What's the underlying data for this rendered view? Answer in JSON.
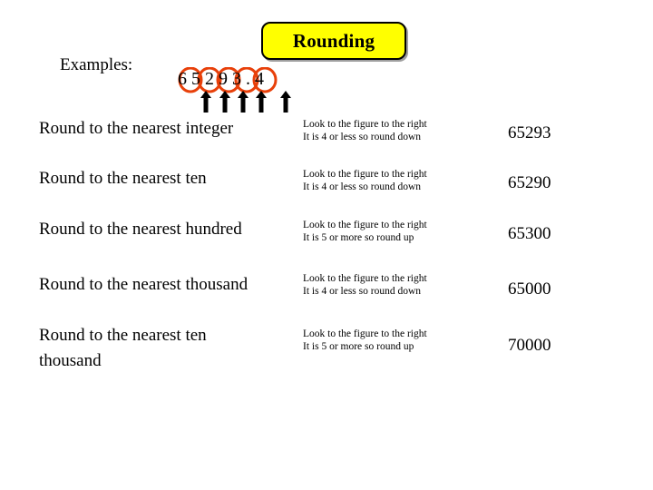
{
  "slide": {
    "title": "Rounding",
    "examples_label": "Examples:",
    "example_number": {
      "digits": "6 5 2 9 3",
      "decimal_part": ". 4",
      "full_text": "6 5 2 9 3 . 4",
      "circled_digits": [
        "6",
        "5",
        "2",
        "9",
        "3"
      ],
      "circle_color": "#e8400a",
      "arrow_color": "#000000",
      "arrow_count": 5
    },
    "title_box": {
      "fill_color": "#ffff00",
      "border_color": "#000000"
    },
    "rows": [
      {
        "label": "Round to the nearest integer",
        "note_line1": "Look to the figure to the right",
        "note_line2": "It is 4 or less so round down",
        "result": "65293"
      },
      {
        "label": "Round to the nearest ten",
        "note_line1": "Look to the figure to the right",
        "note_line2": "It is 4 or less so round down",
        "result": "65290"
      },
      {
        "label": "Round to the nearest hundred",
        "note_line1": "Look to the figure to the right",
        "note_line2": "It is 5 or more so round up",
        "result": "65300"
      },
      {
        "label": "Round to the nearest thousand",
        "note_line1": "Look to the figure to the right",
        "note_line2": "It is 4 or less so round down",
        "result": "65000"
      },
      {
        "label": "Round to the nearest ten thousand",
        "note_line1": "Look to the figure to the right",
        "note_line2": "It is 5 or more so round up",
        "result": "70000"
      }
    ]
  }
}
